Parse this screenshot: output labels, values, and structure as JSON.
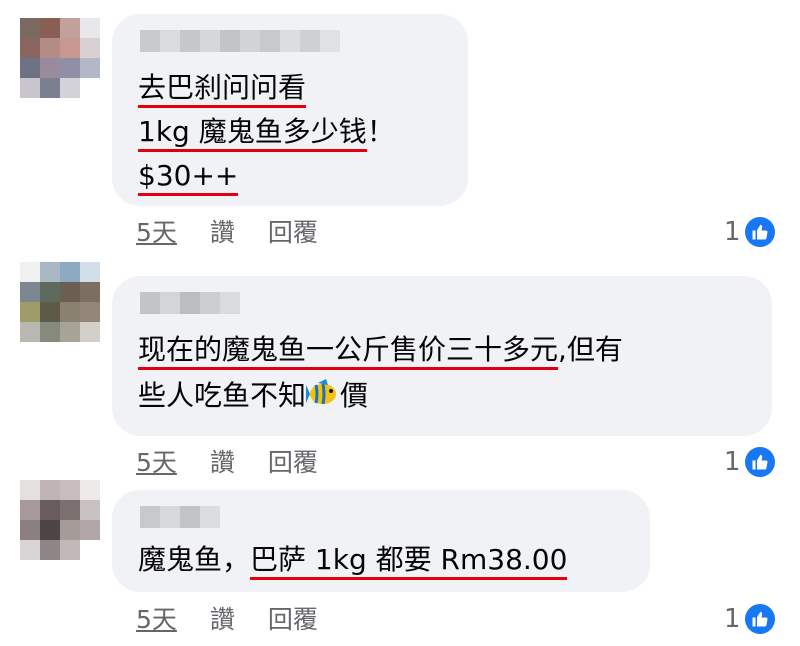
{
  "comments": [
    {
      "lines": [
        {
          "segments": [
            {
              "text": "去巴刹问问看",
              "underline": true
            }
          ]
        },
        {
          "segments": [
            {
              "text": "1kg 魔鬼鱼多少钱",
              "underline": true
            },
            {
              "text": "！",
              "underline": false
            }
          ]
        },
        {
          "segments": [
            {
              "text": "$30++",
              "underline": true
            }
          ]
        }
      ],
      "time": "5天",
      "like_label": "讚",
      "reply_label": "回覆",
      "reaction_count": "1"
    },
    {
      "lines": [
        {
          "segments": [
            {
              "text": "现在的魔鬼鱼一公斤售价三十多元",
              "underline": true
            },
            {
              "text": ",但有",
              "underline": false
            }
          ]
        },
        {
          "segments": [
            {
              "text": "些人吃鱼不知",
              "underline": false
            },
            {
              "emoji": "tropical-fish-emoji"
            },
            {
              "text": "價",
              "underline": false
            }
          ]
        }
      ],
      "time": "5天",
      "like_label": "讚",
      "reply_label": "回覆",
      "reaction_count": "1"
    },
    {
      "lines": [
        {
          "segments": [
            {
              "text": "魔鬼鱼，",
              "underline": false
            },
            {
              "text": "巴萨 1kg 都要 Rm38.00",
              "underline": true
            }
          ]
        }
      ],
      "time": "5天",
      "like_label": "讚",
      "reply_label": "回覆",
      "reaction_count": "1"
    }
  ],
  "icons": {
    "reaction": "thumbs-up-icon",
    "emoji": "tropical-fish-emoji"
  },
  "colors": {
    "bubble": "#f0f2f5",
    "underline": "#e0000f",
    "reaction_blue": "#1877f2",
    "meta_text": "#65676b"
  }
}
